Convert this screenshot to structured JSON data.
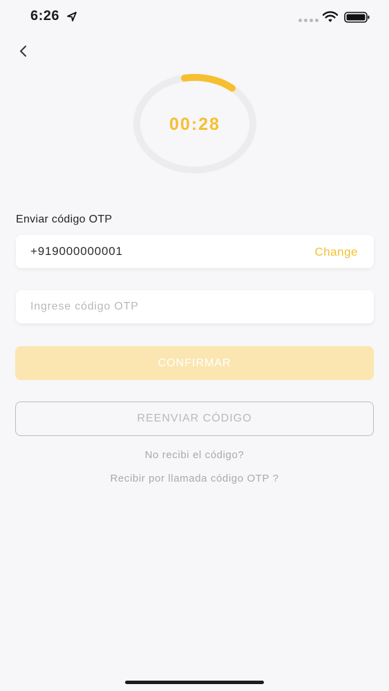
{
  "status_bar": {
    "time": "6:26"
  },
  "timer": {
    "display": "00:28",
    "progress": 0.14,
    "track_color": "#ececec",
    "accent_color": "#f5bf2f"
  },
  "otp_form": {
    "section_label": "Enviar código OTP",
    "phone_number": "+919000000001",
    "change_label": "Change",
    "otp_placeholder": "Ingrese código OTP",
    "otp_value": "",
    "confirm_label": "CONFIRMAR",
    "resend_label": "REENVIAR CÓDIGO",
    "no_code_text": "No recibi el código?",
    "call_otp_text": "Recibir por llamada código OTP ?"
  },
  "icons": {
    "back": "chevron-left-icon",
    "location": "location-arrow-icon",
    "wifi": "wifi-icon",
    "battery": "battery-icon"
  }
}
